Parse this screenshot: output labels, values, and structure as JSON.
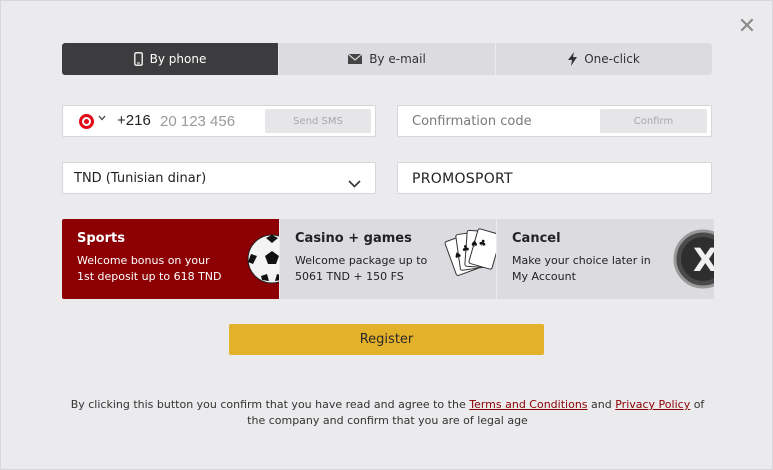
{
  "close": {
    "glyph": "✕"
  },
  "tabs": [
    {
      "label": "By phone",
      "icon": "phone-icon",
      "active": true
    },
    {
      "label": "By e-mail",
      "icon": "envelope-icon",
      "active": false
    },
    {
      "label": "One-click",
      "icon": "lightning-icon",
      "active": false
    }
  ],
  "phone": {
    "country_flag": "tunisia-flag-icon",
    "dial_code": "+216",
    "placeholder": "20 123 456",
    "send_sms_label": "Send SMS"
  },
  "confirmation": {
    "placeholder": "Confirmation code",
    "confirm_label": "Confirm"
  },
  "currency": {
    "selected": "TND (Tunisian dinar)"
  },
  "promo": {
    "value": "PROMOSPORT"
  },
  "bonuses": [
    {
      "title": "Sports",
      "desc_line1": "Welcome bonus on your",
      "desc_line2": "1st deposit up to 618 TND",
      "icon": "soccer-ball-icon",
      "selected": true
    },
    {
      "title": "Casino + games",
      "desc_line1": "Welcome package up to",
      "desc_line2": "5061 TND + 150 FS",
      "icon": "playing-cards-icon",
      "selected": false
    },
    {
      "title": "Cancel",
      "desc_line1": "Make your choice later in",
      "desc_line2": "My Account",
      "icon": "cancel-x-icon",
      "selected": false
    }
  ],
  "register_label": "Register",
  "terms": {
    "part1": "By clicking this button you confirm that you have read and agree to the ",
    "terms_link": "Terms and Conditions",
    "and": " and ",
    "privacy_link": "Privacy Policy",
    "part2": " of the company and confirm that you are of legal age"
  },
  "colors": {
    "accent": "#8c0004",
    "button": "#e4b12a",
    "tab_active": "#3c3c3e"
  }
}
